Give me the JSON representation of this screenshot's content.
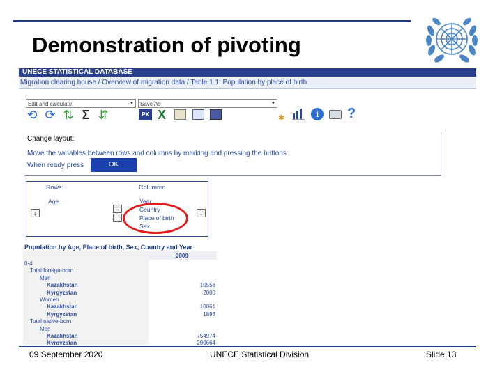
{
  "slide": {
    "title": "Demonstration of pivoting",
    "footer_date": "09 September 2020",
    "footer_org": "UNECE Statistical Division",
    "footer_slide": "Slide 13"
  },
  "app": {
    "db_title": "UNECE STATISTICAL DATABASE",
    "breadcrumb": "Migration clearing house / Overview of migration data / Table 1.1: Population by place of birth"
  },
  "toolbar": {
    "select1": "Edit and calculate",
    "select2": "Save As"
  },
  "layout_panel": {
    "heading": "Change layout:",
    "instruction": "Move the variables between rows and columns by marking and pressing the buttons.",
    "ready_text": "When ready press",
    "ok_label": "OK"
  },
  "pivot": {
    "rows_label": "Rows:",
    "rows_items": [
      "Age"
    ],
    "columns_label": "Columns:",
    "columns_items": [
      "Year",
      "Country",
      "Place of birth",
      "Sex"
    ],
    "right_arrow": "→",
    "left_arrow": "←",
    "down_arrow": "↓"
  },
  "table": {
    "title": "Population by Age, Place of birth, Sex, Country and Year",
    "year_header": "2009",
    "rows": [
      {
        "label": "0-4",
        "value": "",
        "indent": 0,
        "bold": false
      },
      {
        "label": "Total foreign-born",
        "value": "",
        "indent": 1,
        "bold": false
      },
      {
        "label": "Men",
        "value": "",
        "indent": 2,
        "bold": false
      },
      {
        "label": "Kazakhstan",
        "value": "10558",
        "indent": 3,
        "bold": true
      },
      {
        "label": "Kyrgyzstan",
        "value": "2000",
        "indent": 3,
        "bold": true
      },
      {
        "label": "Women",
        "value": "",
        "indent": 2,
        "bold": false
      },
      {
        "label": "Kazakhstan",
        "value": "10061",
        "indent": 3,
        "bold": true
      },
      {
        "label": "Kyrgyzstan",
        "value": "1898",
        "indent": 3,
        "bold": true
      },
      {
        "label": "Total native-born",
        "value": "",
        "indent": 1,
        "bold": false
      },
      {
        "label": "Men",
        "value": "",
        "indent": 2,
        "bold": false
      },
      {
        "label": "Kazakhstan",
        "value": "754974",
        "indent": 3,
        "bold": true
      },
      {
        "label": "Kyrgyzstan",
        "value": "290664",
        "indent": 3,
        "bold": true
      }
    ]
  },
  "icons": {
    "sum_glyph": "Σ",
    "px_label": "PX",
    "xls_glyph": "X",
    "info_glyph": "i",
    "help_glyph": "?"
  },
  "colors": {
    "accent": "#1f3b8f",
    "link": "#2b4aa0",
    "highlight": "#e21b1b",
    "ok_button": "#1b3fae"
  }
}
